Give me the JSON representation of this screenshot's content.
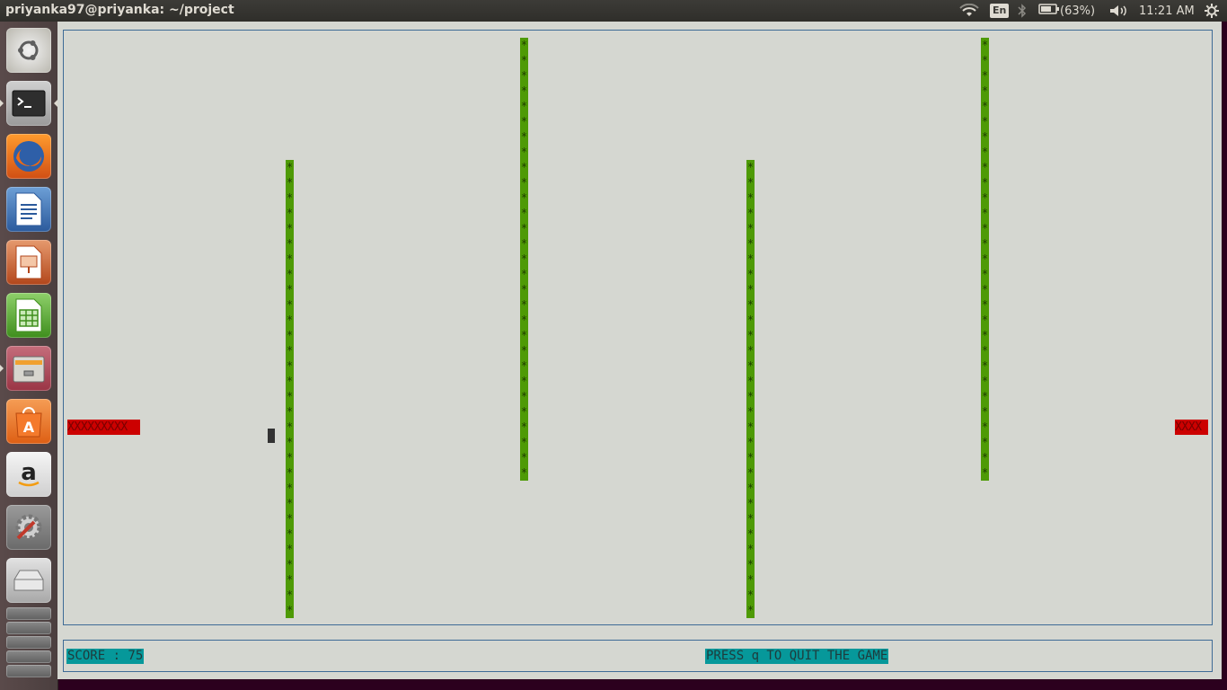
{
  "panel": {
    "window_title": "priyanka97@priyanka: ~/project",
    "language": "En",
    "battery": "(63%)",
    "clock": "11:21 AM"
  },
  "launcher": {
    "items": [
      {
        "name": "ubuntu-dash-icon"
      },
      {
        "name": "terminal-icon"
      },
      {
        "name": "firefox-icon"
      },
      {
        "name": "writer-icon"
      },
      {
        "name": "impress-icon"
      },
      {
        "name": "calc-icon"
      },
      {
        "name": "files-icon"
      },
      {
        "name": "software-center-icon"
      },
      {
        "name": "amazon-icon"
      },
      {
        "name": "system-settings-icon"
      },
      {
        "name": "disk-icon"
      }
    ]
  },
  "game": {
    "pillar_glyph": "*",
    "left_block": "XXXXXXXXX",
    "right_block": "XXXX",
    "score_label": "SCORE : 75",
    "quit_hint": "PRESS q TO QUIT THE GAME"
  },
  "colors": {
    "terminal_bg": "#d5d7d1",
    "pillar": "#4e9a06",
    "wall": "#cc0000",
    "status": "#06989a",
    "border": "#3e6b96"
  }
}
